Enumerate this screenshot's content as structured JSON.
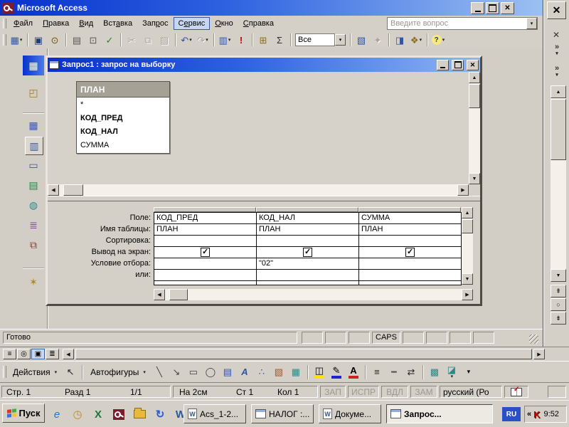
{
  "icons": {
    "close": "✕",
    "chevron": "»",
    "dropdown": "▾",
    "up": "▲",
    "down": "▼",
    "left": "◀",
    "right": "▶",
    "browse_prev": "⇞",
    "browse_select": "○",
    "browse_next": "⇟"
  },
  "colors": {
    "title_gradient_left": "#0831cc",
    "title_gradient_right": "#9cc0f2",
    "chrome": "#d4d0c8",
    "table_header_gray": "#a5a195",
    "run_red": "#c00000",
    "ru_badge_blue": "#2a50c8"
  },
  "access": {
    "title": "Microsoft Access",
    "ask_placeholder": "Введите вопрос",
    "menu": {
      "items": [
        {
          "name": "file",
          "label": "Файл",
          "accel": 0
        },
        {
          "name": "edit",
          "label": "Правка",
          "accel": 0
        },
        {
          "name": "view",
          "label": "Вид",
          "accel": 0
        },
        {
          "name": "insert",
          "label": "Вставка",
          "accel": 3
        },
        {
          "name": "query",
          "label": "Запрос",
          "accel": 3
        },
        {
          "name": "tools",
          "label": "Сервис",
          "accel": 1,
          "highlight": true
        },
        {
          "name": "window",
          "label": "Окно",
          "accel": 0
        },
        {
          "name": "help",
          "label": "Справка",
          "accel": 0
        }
      ]
    },
    "toolbar": {
      "combo_value": "Все",
      "buttons": [
        {
          "name": "view-button",
          "glyph": "▦",
          "color": "#3555a0",
          "dropdown": true
        },
        {
          "sep": true
        },
        {
          "name": "save-button",
          "glyph": "▣",
          "color": "#203a7a"
        },
        {
          "name": "file-search-button",
          "glyph": "⊙",
          "color": "#705010"
        },
        {
          "sep": true
        },
        {
          "name": "print-button",
          "glyph": "▤",
          "color": "#585858"
        },
        {
          "name": "print-preview-button",
          "glyph": "⊡",
          "color": "#585858"
        },
        {
          "name": "spelling-button",
          "glyph": "✓",
          "color": "#2e7d32"
        },
        {
          "sep": true
        },
        {
          "name": "cut-button",
          "glyph": "✂",
          "disabled": true
        },
        {
          "name": "copy-button",
          "glyph": "⧉",
          "disabled": true
        },
        {
          "name": "paste-button",
          "glyph": "▨",
          "disabled": true
        },
        {
          "sep": true
        },
        {
          "name": "undo-button",
          "glyph": "↶",
          "color": "#3555a0",
          "dropdown": true
        },
        {
          "name": "redo-button",
          "glyph": "↷",
          "disabled": true,
          "dropdown": true
        },
        {
          "sep": true
        },
        {
          "name": "query-type-button",
          "glyph": "▥",
          "color": "#3555a0",
          "dropdown": true
        },
        {
          "name": "run-button",
          "glyph": "!",
          "color": "#c00000",
          "boldglyph": true
        },
        {
          "sep": true
        },
        {
          "name": "show-table-button",
          "glyph": "⊞",
          "color": "#8a6d1a"
        },
        {
          "name": "totals-button",
          "glyph": "Σ",
          "color": "#303030"
        },
        {
          "sep": true
        },
        {
          "combo": true,
          "name": "top-values-combo"
        },
        {
          "sep": true
        },
        {
          "name": "properties-button",
          "glyph": "▧",
          "color": "#3555a0"
        },
        {
          "name": "build-button",
          "glyph": "✦",
          "disabled": true
        },
        {
          "sep": true
        },
        {
          "name": "database-window-button",
          "glyph": "◨",
          "color": "#3555a0"
        },
        {
          "name": "new-object-button",
          "glyph": "❖",
          "color": "#8a6d1a",
          "dropdown": true
        },
        {
          "sep": true
        },
        {
          "name": "help-button",
          "glyph": "?",
          "color": "#1a3a8a",
          "bubble": true,
          "dropdown": true
        }
      ]
    },
    "db_panel": {
      "icons": [
        {
          "name": "database-window-icon",
          "glyph": "▦"
        },
        {
          "name": "open-object-icon",
          "glyph": "◰",
          "color": "#a8781e"
        },
        {
          "name": "tables-icon",
          "glyph": "▦",
          "color": "#3a5aa0"
        },
        {
          "name": "queries-icon",
          "glyph": "▥",
          "color": "#3a5aa0",
          "pressed": true
        },
        {
          "name": "forms-icon",
          "glyph": "▭",
          "color": "#3a5aa0"
        },
        {
          "name": "reports-icon",
          "glyph": "▤",
          "color": "#3a7a4a"
        },
        {
          "name": "pages-icon",
          "glyph": "◍",
          "color": "#2a8a8a"
        },
        {
          "name": "macros-icon",
          "glyph": "≣",
          "color": "#7a4a9a"
        },
        {
          "name": "modules-icon",
          "glyph": "⧉",
          "color": "#8a3a3a"
        },
        {
          "name": "favorites-icon",
          "glyph": "✶",
          "color": "#b08820"
        }
      ]
    },
    "query_window": {
      "title": "Запрос1 : запрос на выборку",
      "field_list": {
        "table_name": "ПЛАН",
        "fields": [
          {
            "name": "*",
            "bold": false
          },
          {
            "name": "КОД_ПРЕД",
            "bold": true
          },
          {
            "name": "КОД_НАЛ",
            "bold": true
          },
          {
            "name": "СУММА",
            "bold": false
          }
        ]
      },
      "grid": {
        "row_labels": [
          "Поле:",
          "Имя таблицы:",
          "Сортировка:",
          "Вывод на экран:",
          "Условие отбора:",
          "или:"
        ],
        "columns": [
          {
            "field": "КОД_ПРЕД",
            "table": "ПЛАН",
            "sort": "",
            "show": true,
            "criteria": "",
            "or": ""
          },
          {
            "field": "КОД_НАЛ",
            "table": "ПЛАН",
            "sort": "",
            "show": true,
            "criteria": "\"02\"",
            "or": ""
          },
          {
            "field": "СУММА",
            "table": "ПЛАН",
            "sort": "",
            "show": true,
            "criteria": "",
            "or": ""
          }
        ]
      }
    },
    "status_bar": {
      "message": "Готово",
      "caps_indicator": "CAPS"
    }
  },
  "word": {
    "view_buttons": [
      {
        "name": "normal-view-button",
        "glyph": "≡"
      },
      {
        "name": "web-layout-button",
        "glyph": "◎"
      },
      {
        "name": "print-layout-button",
        "glyph": "▣",
        "pressed": true
      },
      {
        "name": "outline-view-button",
        "glyph": "≣"
      }
    ],
    "drawing_toolbar": {
      "items": [
        {
          "name": "actions-menu",
          "label": "Действия",
          "dropdown": true
        },
        {
          "name": "select-objects-button",
          "glyph": "↖",
          "color": "#222222"
        },
        {
          "sep": true
        },
        {
          "name": "autoshapes-menu",
          "label": "Автофигуры",
          "dropdown": true
        },
        {
          "name": "line-button",
          "glyph": "╲",
          "color": "#444444"
        },
        {
          "name": "arrow-button",
          "glyph": "↘",
          "color": "#444444"
        },
        {
          "name": "rectangle-button",
          "glyph": "▭",
          "color": "#444444"
        },
        {
          "name": "oval-button",
          "glyph": "◯",
          "color": "#444444"
        },
        {
          "name": "text-box-button",
          "glyph": "▤",
          "color": "#2b579a"
        },
        {
          "name": "wordart-button",
          "glyph": "A",
          "color": "#2b579a",
          "boldglyph": true,
          "italicglyph": true
        },
        {
          "name": "diagram-button",
          "glyph": "∴",
          "color": "#2b579a"
        },
        {
          "name": "clip-art-button",
          "glyph": "▧",
          "color": "#a05a2a"
        },
        {
          "name": "picture-button",
          "glyph": "▦",
          "color": "#2a8a8a"
        },
        {
          "sep": true
        },
        {
          "name": "fill-color-button",
          "glyph": "◫",
          "bar": "#ffe400",
          "dropdown": true
        },
        {
          "name": "line-color-button",
          "glyph": "✎",
          "bar": "#2222cc",
          "dropdown": true
        },
        {
          "name": "font-color-button",
          "glyph": "А",
          "bar": "#cc2222",
          "boldglyph": true,
          "dropdown": true
        },
        {
          "sep": true
        },
        {
          "name": "line-style-button",
          "glyph": "≡",
          "color": "#222222"
        },
        {
          "name": "dash-style-button",
          "glyph": "┅",
          "color": "#222222"
        },
        {
          "name": "arrow-style-button",
          "glyph": "⇄",
          "color": "#222222"
        },
        {
          "sep": true
        },
        {
          "name": "shadow-style-button",
          "glyph": "▩",
          "color": "#2a8a8a"
        },
        {
          "name": "threed-style-button",
          "glyph": "◪",
          "color": "#2a8a8a",
          "dropdown": true
        },
        {
          "name": "toolbar-options",
          "glyph": "▾",
          "small": true
        }
      ]
    },
    "status_bar": {
      "page": "Стр. 1",
      "section": "Разд 1",
      "page_of_total": "1/1",
      "position": "На 2см",
      "line": "Ст 1",
      "column": "Кол 1",
      "toggles": [
        "ЗАП",
        "ИСПР",
        "ВДЛ",
        "ЗАМ"
      ],
      "language": "русский (Ро"
    }
  },
  "taskbar": {
    "start_label": "Пуск",
    "quick_launch": [
      {
        "name": "ie-icon",
        "glyph": "e",
        "color": "#1e78d0",
        "italic": true
      },
      {
        "name": "outlook-icon",
        "glyph": "◷",
        "color": "#c8881e"
      },
      {
        "name": "excel-icon",
        "glyph": "X",
        "color": "#1a7a3a",
        "bold": true
      },
      {
        "name": "access-key-icon",
        "type": "key"
      },
      {
        "name": "folder-icon",
        "type": "folder"
      },
      {
        "name": "refresh-icon",
        "glyph": "↻",
        "color": "#2a5ad8",
        "bold": true
      },
      {
        "name": "word-icon",
        "glyph": "W",
        "color": "#2b579a",
        "bold": true
      }
    ],
    "tasks": [
      {
        "label": "Acs_1-2...",
        "icon": "word-doc"
      },
      {
        "label": "НАЛОГ :...",
        "icon": "access-db"
      },
      {
        "label": "Докуме...",
        "icon": "word-doc"
      },
      {
        "label": "Запрос...",
        "icon": "query",
        "active": true
      }
    ],
    "tray": {
      "language_badge": "RU",
      "collapse": "«",
      "antivirus": "K",
      "clock": "9:52"
    }
  }
}
